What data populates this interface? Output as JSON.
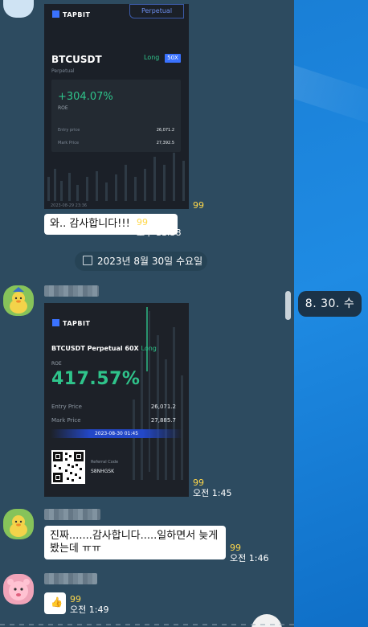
{
  "date_tooltip": "8. 30. 수",
  "date_divider": "2023년 8월 30일 수요일",
  "messages": {
    "card1": {
      "brand": "TAPBIT",
      "tag": "Perpetual",
      "symbol": "BTCUSDT",
      "subtitle": "Perpetual",
      "side": "Long",
      "leverage": "50X",
      "roe_value": "+304.07%",
      "roe_label": "ROE",
      "entry_label": "Entry price",
      "entry_value": "26,071.2",
      "mark_label": "Mark Price",
      "mark_value": "27,392.5",
      "timestamp": "2023-08-29 23:36",
      "unread": "99"
    },
    "reply1": {
      "text": "와.. 감사합니다!!!",
      "unread": "99",
      "time": "오후 11:38"
    },
    "card2": {
      "brand": "TAPBIT",
      "title": "BTCUSDT Perpetual  60X",
      "side": "Long",
      "roe_label": "ROE",
      "roe_value": "417.57%",
      "entry_label": "Entry Price",
      "entry_value": "26,071.2",
      "mark_label": "Mark Price",
      "mark_value": "27,885.7",
      "date": "2023-08-30 01:45",
      "ref_label": "Referral Code",
      "ref_code": "S8NHGSK",
      "unread": "99",
      "time": "오전 1:45"
    },
    "msg3": {
      "text": "진짜.......감사합니다.....일하면서 늦게 봤는데 ㅠㅠ",
      "unread": "99",
      "time": "오전 1:46"
    },
    "msg4": {
      "icon": "thumbs-up-icon",
      "unread": "99",
      "time": "오전 1:49"
    }
  },
  "colors": {
    "chat_bg": "#2d4b60",
    "accent_green": "#2fc48b",
    "unread": "#ffd84a",
    "desktop_blue": "#1a7fd6"
  }
}
